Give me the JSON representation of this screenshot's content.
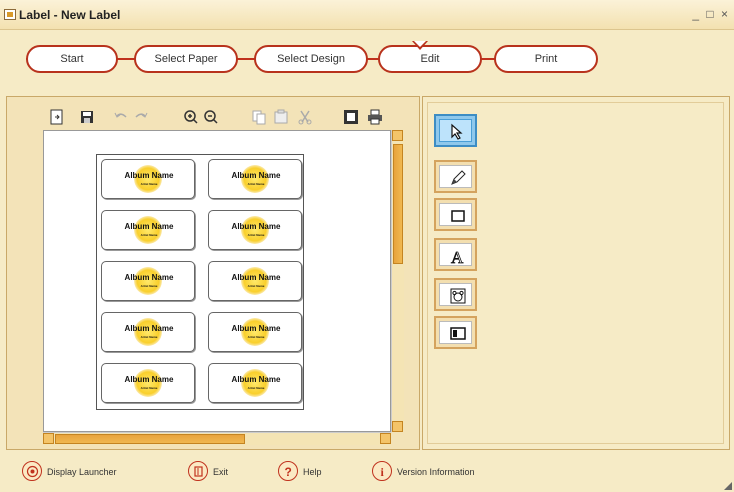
{
  "window": {
    "title": "Label - New Label",
    "controls": "_ □ ×"
  },
  "wizard": {
    "steps": [
      {
        "label": "Start"
      },
      {
        "label": "Select Paper"
      },
      {
        "label": "Select Design"
      },
      {
        "label": "Edit",
        "active": true
      },
      {
        "label": "Print"
      }
    ]
  },
  "toolbar": {
    "icons": [
      "import-icon",
      "save-icon",
      "undo-icon",
      "redo-icon",
      "zoom-in-icon",
      "zoom-out-icon",
      "copy-icon",
      "paste-icon",
      "cut-icon",
      "fill-color-icon",
      "print-icon"
    ]
  },
  "labels": {
    "title": "Album Name",
    "subtitle": "Artist Name",
    "count": 10
  },
  "tools": [
    {
      "name": "select-tool",
      "icon": "arrow-pointer-icon",
      "selected": true
    },
    {
      "name": "pen-tool",
      "icon": "pencil-icon"
    },
    {
      "name": "rectangle-tool",
      "icon": "rectangle-icon"
    },
    {
      "name": "text-tool",
      "icon": "letter-a-icon"
    },
    {
      "name": "clipart-tool",
      "icon": "bear-face-icon"
    },
    {
      "name": "image-tool",
      "icon": "picture-frame-icon"
    }
  ],
  "footer": {
    "display_launcher": "Display Launcher",
    "exit": "Exit",
    "help": "Help",
    "version": "Version Information"
  },
  "colors": {
    "accent": "#b8321c",
    "background": "#f6ebc6",
    "scroll_thumb": "#e8a33c",
    "selected_tool": "#8fc8ec"
  }
}
